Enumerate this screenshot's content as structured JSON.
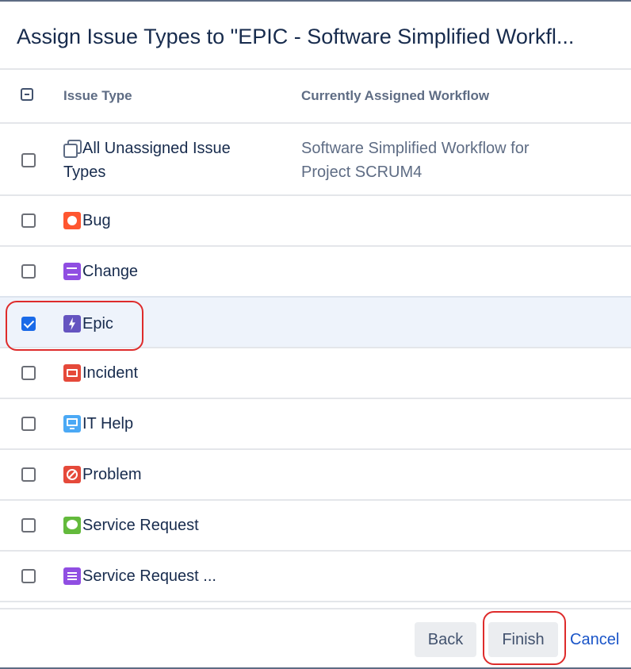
{
  "dialog": {
    "title": "Assign Issue Types to \"EPIC - Software Simplified Workfl..."
  },
  "table": {
    "headers": {
      "issue_type": "Issue Type",
      "workflow": "Currently Assigned Workflow"
    },
    "rows": [
      {
        "label_line1": "All Unassigned Issue",
        "label_line2": "Types",
        "icon": "unassigned-stack-icon",
        "checked": false,
        "workflow_line1": "Software Simplified Workflow for",
        "workflow_line2": "Project SCRUM4"
      },
      {
        "label": "Bug",
        "icon": "bug-icon",
        "checked": false
      },
      {
        "label": "Change",
        "icon": "change-icon",
        "checked": false
      },
      {
        "label": "Epic",
        "icon": "epic-icon",
        "checked": true
      },
      {
        "label": "Incident",
        "icon": "incident-icon",
        "checked": false
      },
      {
        "label": "IT Help",
        "icon": "it-help-icon",
        "checked": false
      },
      {
        "label": "Problem",
        "icon": "problem-icon",
        "checked": false
      },
      {
        "label": "Service Request",
        "icon": "service-request-icon",
        "checked": false
      },
      {
        "label": "Service Request ...",
        "icon": "service-request-list-icon",
        "checked": false
      }
    ]
  },
  "footer": {
    "back_label": "Back",
    "finish_label": "Finish",
    "cancel_label": "Cancel"
  },
  "colors": {
    "accent": "#1a6ae8",
    "annotation": "#de2b2b",
    "selected_row": "#eef3fb"
  }
}
